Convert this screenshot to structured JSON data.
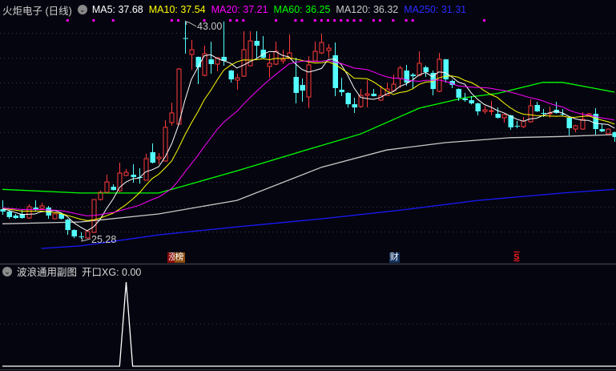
{
  "header": {
    "stock_title": "火炬电子 (日线)",
    "ma_labels": [
      {
        "text": "MA5: 37.68",
        "color": "#ffffff"
      },
      {
        "text": "MA10: 37.54",
        "color": "#ffff00"
      },
      {
        "text": "MA20: 37.21",
        "color": "#ff00ff"
      },
      {
        "text": "MA60: 36.25",
        "color": "#00ff00"
      },
      {
        "text": "MA120: 36.32",
        "color": "#c8c8c8"
      },
      {
        "text": "MA250: 31.31",
        "color": "#2a2aff"
      }
    ]
  },
  "annotations": {
    "high_label": "43.00",
    "low_label": "25.28",
    "high_index": 28,
    "low_index": 12
  },
  "event_tags": [
    {
      "text": "涨",
      "index": 26,
      "bg": "#8a0a0a"
    },
    {
      "text": "榜",
      "index": 27,
      "bg": "#8a4a10"
    },
    {
      "text": "财",
      "index": 60,
      "bg": "#12325e"
    },
    {
      "text": "S",
      "index": 79,
      "bg": "transparent"
    }
  ],
  "subchart": {
    "title": "波浪通用副图",
    "indicator": "开口XG: 0.00",
    "values_nonzero": [
      {
        "index": 19,
        "value": 1
      }
    ]
  },
  "chart_data": {
    "type": "candlestick",
    "y_range": [
      24.5,
      43.4
    ],
    "colors": {
      "up": "#ff3a3a",
      "down": "#54ffff",
      "background": "#05050f"
    },
    "signal_indices": [
      10,
      14,
      17,
      26,
      27,
      31,
      35,
      36,
      37,
      42,
      45,
      46,
      48,
      49,
      50,
      51,
      52,
      53,
      54,
      55,
      57,
      58,
      60,
      62,
      63,
      74
    ],
    "ohlc": [
      [
        27.69,
        28.41,
        27.23,
        27.49
      ],
      [
        27.49,
        27.62,
        26.91,
        27.04
      ],
      [
        27.17,
        27.3,
        26.91,
        26.97
      ],
      [
        27.3,
        27.62,
        26.91,
        26.97
      ],
      [
        26.97,
        28.08,
        26.9,
        27.89
      ],
      [
        27.82,
        28.41,
        27.56,
        27.62
      ],
      [
        27.75,
        28.21,
        27.7,
        27.95
      ],
      [
        27.82,
        27.95,
        26.91,
        27.17
      ],
      [
        26.91,
        27.35,
        26.85,
        27.3
      ],
      [
        27.3,
        27.35,
        26.85,
        26.91
      ],
      [
        26.84,
        26.9,
        25.6,
        25.99
      ],
      [
        25.99,
        26.05,
        25.34,
        25.47
      ],
      [
        25.47,
        25.8,
        25.28,
        25.45
      ],
      [
        25.35,
        25.99,
        25.3,
        25.87
      ],
      [
        25.8,
        28.5,
        25.75,
        28.47
      ],
      [
        28.47,
        29.19,
        28.4,
        29.06
      ],
      [
        29.06,
        30.49,
        29.0,
        29.9
      ],
      [
        29.51,
        29.71,
        29.2,
        29.25
      ],
      [
        29.19,
        31.47,
        29.06,
        30.62
      ],
      [
        30.43,
        30.95,
        30.38,
        30.69
      ],
      [
        30.49,
        31.34,
        29.84,
        30.3
      ],
      [
        30.3,
        31.01,
        29.77,
        30.23
      ],
      [
        30.04,
        32.19,
        30.0,
        31.79
      ],
      [
        32.32,
        33.03,
        31.4,
        31.47
      ],
      [
        31.79,
        32.25,
        31.34,
        31.92
      ],
      [
        31.6,
        34.92,
        31.55,
        34.34
      ],
      [
        34.73,
        36.35,
        34.47,
        35.51
      ],
      [
        34.6,
        39.15,
        34.55,
        39.09
      ],
      [
        41.6,
        43.0,
        40.33,
        41.55
      ],
      [
        40.26,
        41.44,
        39.03,
        40.65
      ],
      [
        40.07,
        40.1,
        37.85,
        39.22
      ],
      [
        38.57,
        40.98,
        38.5,
        40.33
      ],
      [
        39.87,
        41.31,
        38.7,
        39.48
      ],
      [
        39.48,
        40.05,
        38.9,
        40.0
      ],
      [
        40.07,
        42.95,
        39.35,
        39.74
      ],
      [
        38.96,
        39.0,
        37.98,
        38.24
      ],
      [
        38.18,
        38.7,
        37.4,
        38.37
      ],
      [
        38.5,
        42.15,
        38.45,
        40.65
      ],
      [
        39.35,
        42.15,
        39.3,
        41.37
      ],
      [
        41.37,
        42.15,
        39.94,
        40.98
      ],
      [
        40.65,
        41.76,
        39.95,
        40.0
      ],
      [
        39.29,
        40.33,
        38.37,
        39.55
      ],
      [
        39.48,
        41.31,
        39.4,
        40.52
      ],
      [
        39.74,
        40.65,
        39.5,
        39.87
      ],
      [
        39.94,
        41.89,
        39.9,
        40.39
      ],
      [
        38.44,
        40.0,
        36.29,
        37.14
      ],
      [
        37.79,
        38.31,
        36.42,
        37.33
      ],
      [
        36.81,
        40.13,
        35.9,
        39.42
      ],
      [
        39.74,
        41.31,
        39.7,
        40.52
      ],
      [
        40.39,
        41.96,
        40.3,
        41.24
      ],
      [
        40.59,
        41.11,
        40.0,
        40.78
      ],
      [
        40.2,
        41.24,
        36.88,
        37.53
      ],
      [
        37.4,
        38.37,
        36.88,
        37.2
      ],
      [
        37.14,
        37.2,
        35.96,
        36.22
      ],
      [
        36.22,
        36.75,
        35.51,
        35.96
      ],
      [
        36.03,
        37.46,
        35.95,
        36.94
      ],
      [
        36.94,
        38.18,
        35.96,
        37.07
      ],
      [
        37.07,
        37.46,
        36.85,
        36.88
      ],
      [
        36.55,
        37.72,
        36.5,
        36.94
      ],
      [
        36.94,
        37.98,
        36.9,
        37.46
      ],
      [
        37.33,
        38.63,
        37.3,
        37.85
      ],
      [
        38.31,
        39.35,
        37.53,
        39.16
      ],
      [
        38.96,
        39.42,
        37.72,
        37.98
      ],
      [
        38.63,
        38.76,
        37.53,
        38.5
      ],
      [
        38.57,
        40.52,
        38.5,
        39.55
      ],
      [
        39.22,
        39.35,
        38.44,
        38.83
      ],
      [
        38.77,
        38.96,
        36.94,
        37.46
      ],
      [
        37.27,
        40.39,
        37.2,
        39.87
      ],
      [
        39.87,
        39.9,
        37.98,
        38.24
      ],
      [
        38.11,
        38.2,
        37.53,
        37.79
      ],
      [
        37.46,
        37.5,
        36.49,
        36.75
      ],
      [
        36.68,
        37.14,
        36.42,
        36.55
      ],
      [
        36.55,
        36.88,
        36.2,
        36.29
      ],
      [
        36.29,
        36.35,
        35.31,
        35.64
      ],
      [
        35.64,
        36.09,
        35.44,
        35.77
      ],
      [
        35.64,
        36.49,
        35.31,
        35.7
      ],
      [
        35.44,
        35.96,
        35.05,
        35.12
      ],
      [
        35.12,
        35.45,
        34.73,
        35.38
      ],
      [
        35.31,
        35.35,
        34.14,
        34.34
      ],
      [
        34.47,
        34.86,
        34.27,
        34.45
      ],
      [
        34.4,
        35.18,
        34.27,
        34.86
      ],
      [
        34.79,
        36.62,
        34.73,
        36.09
      ],
      [
        36.16,
        36.42,
        35.6,
        35.64
      ],
      [
        35.51,
        35.83,
        35.18,
        35.5
      ],
      [
        35.44,
        36.03,
        35.12,
        35.51
      ],
      [
        35.77,
        36.42,
        35.45,
        35.51
      ],
      [
        35.44,
        35.83,
        35.3,
        35.38
      ],
      [
        35.12,
        35.2,
        33.68,
        34.27
      ],
      [
        34.2,
        34.55,
        33.94,
        34.47
      ],
      [
        34.2,
        35.57,
        34.15,
        34.99
      ],
      [
        35.25,
        35.51,
        35.2,
        35.44
      ],
      [
        35.44,
        35.9,
        33.75,
        34.2
      ],
      [
        34.2,
        34.6,
        33.95,
        34.01
      ],
      [
        33.81,
        34.25,
        33.75,
        34.2
      ],
      [
        33.94,
        34.0,
        33.16,
        33.55
      ]
    ],
    "ma_short_periods": [
      5,
      10,
      20
    ],
    "ma_long": [
      {
        "name": "MA60",
        "color": "#00ff00",
        "idx": [
          0,
          12,
          24,
          28,
          36,
          46,
          55,
          64,
          71,
          76,
          83,
          86,
          91,
          94
        ],
        "values": [
          29.3,
          29.0,
          29.0,
          29.6,
          30.8,
          32.4,
          33.8,
          35.9,
          36.75,
          37.1,
          38.0,
          38.0,
          37.5,
          37.2
        ]
      },
      {
        "name": "MA120",
        "color": "#c8c8c8",
        "idx": [
          0,
          12,
          24,
          36,
          49,
          59,
          68,
          78,
          86,
          94
        ],
        "values": [
          26.5,
          26.65,
          27.3,
          28.4,
          31.1,
          32.5,
          33.1,
          33.5,
          33.6,
          33.75
        ]
      },
      {
        "name": "MA250",
        "color": "#1a1aff",
        "idx": [
          6,
          12,
          24,
          36,
          49,
          61,
          73,
          86,
          94
        ],
        "values": [
          24.5,
          24.7,
          25.6,
          26.25,
          26.9,
          27.6,
          28.4,
          29.0,
          29.3
        ]
      }
    ]
  }
}
